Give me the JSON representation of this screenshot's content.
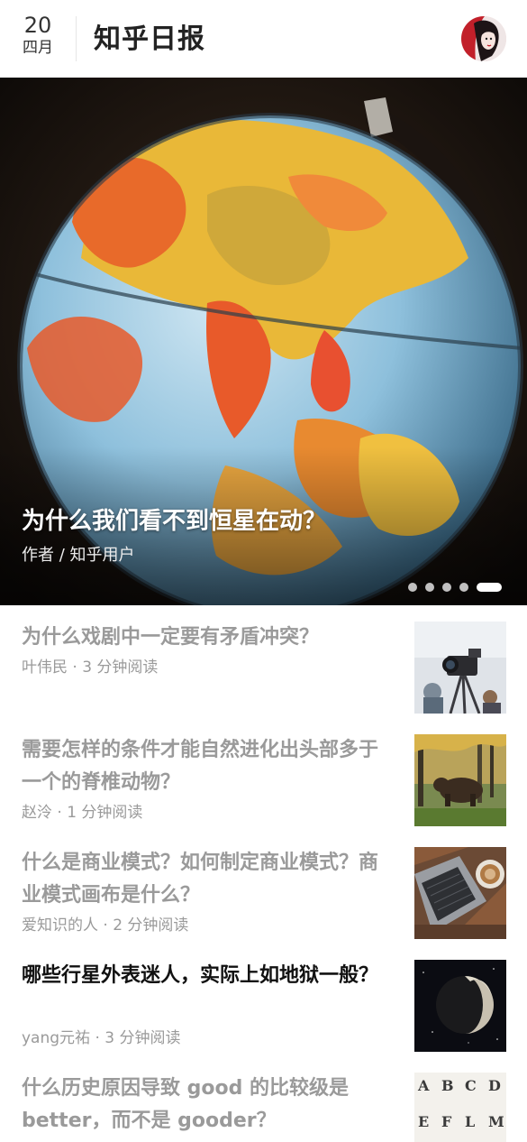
{
  "header": {
    "day": "20",
    "month": "四月",
    "app_title": "知乎日报"
  },
  "hero": {
    "title": "为什么我们看不到恒星在动？",
    "author": "作者 / 知乎用户",
    "slide_count": 5,
    "active_slide": 5
  },
  "stories": [
    {
      "title": "为什么戏剧中一定要有矛盾冲突？",
      "meta": "叶伟民 · 3 分钟阅读",
      "read": true,
      "thumb": "camera-photo"
    },
    {
      "title": "需要怎样的条件才能自然进化出头部多于一个的脊椎动物？",
      "meta": "赵泠 · 1 分钟阅读",
      "read": true,
      "thumb": "bear-photo"
    },
    {
      "title": "什么是商业模式？如何制定商业模式？商业模式画布是什么？",
      "meta": "爱知识的人 · 2 分钟阅读",
      "read": true,
      "thumb": "laptop-coffee-photo"
    },
    {
      "title": "哪些行星外表迷人，实际上如地狱一般？",
      "meta": "yang元祐 · 3 分钟阅读",
      "read": false,
      "thumb": "planet-photo"
    },
    {
      "title": "什么历史原因导致 good 的比较级是 better，而不是 gooder？",
      "meta": "",
      "read": true,
      "thumb": "letters-photo",
      "thumb_letters": [
        "A",
        "B",
        "C",
        "D",
        "E",
        "F",
        "L",
        "M"
      ]
    }
  ],
  "colors": {
    "read_title": "#9a9a9a",
    "unread_title": "#111111",
    "meta": "#9a9a9a"
  }
}
